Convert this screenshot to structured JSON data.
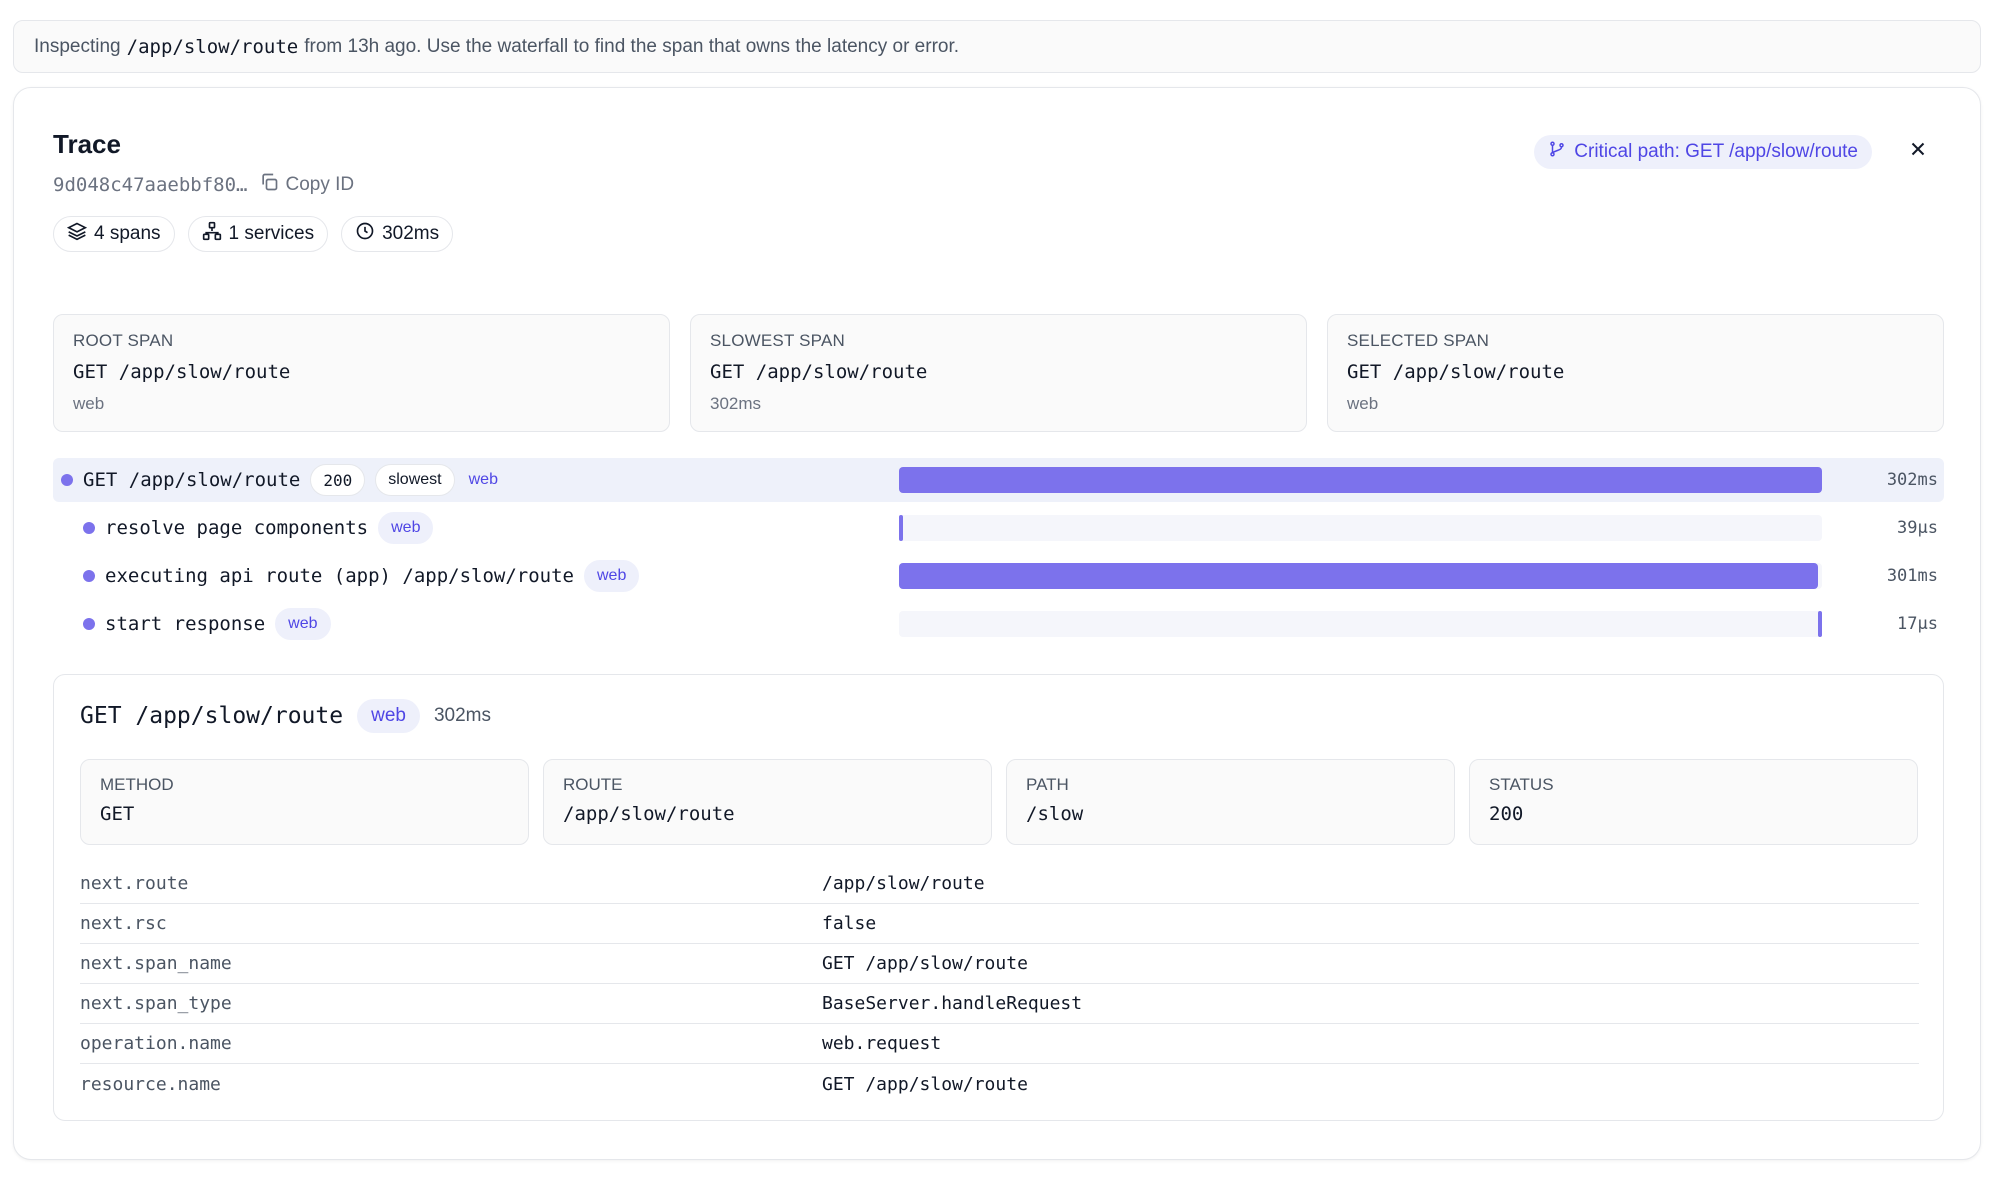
{
  "banner": {
    "prefix": "Inspecting",
    "route": "/app/slow/route",
    "suffix": "from 13h ago. Use the waterfall to find the span that owns the latency or error."
  },
  "trace": {
    "title": "Trace",
    "id": "9d048c47aaebbf80…",
    "copy_label": "Copy ID",
    "pills": {
      "spans": "4 spans",
      "services": "1 services",
      "duration": "302ms"
    },
    "critical_path": "Critical path: GET /app/slow/route"
  },
  "summary": [
    {
      "label": "ROOT SPAN",
      "value": "GET /app/slow/route",
      "sub": "web"
    },
    {
      "label": "SLOWEST SPAN",
      "value": "GET /app/slow/route",
      "sub": "302ms"
    },
    {
      "label": "SELECTED SPAN",
      "value": "GET /app/slow/route",
      "sub": "web"
    }
  ],
  "waterfall": {
    "total_ms": 302,
    "spans": [
      {
        "name": "GET /app/slow/route",
        "status": "200",
        "tag": "slowest",
        "service": "web",
        "duration": "302ms",
        "start_frac": 0.0,
        "width_frac": 1.0,
        "depth": 0,
        "selected": true
      },
      {
        "name": "resolve page components",
        "service": "web",
        "duration": "39μs",
        "start_frac": 0.0,
        "width_frac": 0.004,
        "depth": 1,
        "selected": false
      },
      {
        "name": "executing api route (app) /app/slow/route",
        "service": "web",
        "duration": "301ms",
        "start_frac": 0.0,
        "width_frac": 0.996,
        "depth": 1,
        "selected": false
      },
      {
        "name": "start response",
        "service": "web",
        "duration": "17μs",
        "start_frac": 0.996,
        "width_frac": 0.004,
        "depth": 1,
        "selected": false
      }
    ]
  },
  "detail": {
    "name": "GET /app/slow/route",
    "service": "web",
    "duration": "302ms",
    "fields": [
      {
        "label": "METHOD",
        "value": "GET"
      },
      {
        "label": "ROUTE",
        "value": "/app/slow/route"
      },
      {
        "label": "PATH",
        "value": "/slow"
      },
      {
        "label": "STATUS",
        "value": "200"
      }
    ],
    "attributes": [
      {
        "key": "next.route",
        "value": "/app/slow/route"
      },
      {
        "key": "next.rsc",
        "value": "false"
      },
      {
        "key": "next.span_name",
        "value": "GET /app/slow/route"
      },
      {
        "key": "next.span_type",
        "value": "BaseServer.handleRequest"
      },
      {
        "key": "operation.name",
        "value": "web.request"
      },
      {
        "key": "resource.name",
        "value": "GET /app/slow/route"
      }
    ]
  },
  "colors": {
    "accent": "#7c72ec",
    "accent_text": "#4f46e5",
    "selected_row": "#eef1fa"
  }
}
